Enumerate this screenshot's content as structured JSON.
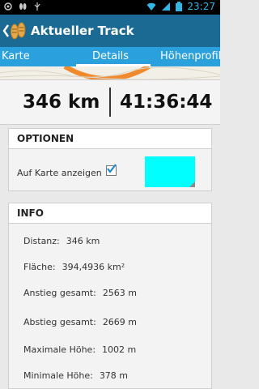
{
  "status_bar": {
    "time": "23:27",
    "icons": [
      "location-icon",
      "footprints-icon",
      "usb-icon",
      "wifi-icon",
      "signal-icon",
      "battery-icon"
    ]
  },
  "action_bar": {
    "title": "Aktueller Track",
    "icons": [
      "back-chevron-icon",
      "footprints-logo-icon"
    ]
  },
  "tabs": {
    "left": "Karte",
    "center": "Details",
    "right": "Höhenprofil"
  },
  "stats": {
    "distance": "346 km",
    "duration": "41:36:44"
  },
  "options": {
    "title": "OPTIONEN",
    "show_on_map_label": "Auf Karte anzeigen",
    "show_on_map_checked": true,
    "track_color": "#00ffff"
  },
  "info": {
    "title": "INFO",
    "rows": [
      {
        "label": "Distanz:",
        "value": "346 km"
      },
      {
        "label": "Fläche:",
        "value": "394,4936 km²"
      },
      {
        "label": "Anstieg gesamt:",
        "value": "2563 m"
      },
      {
        "label": "Abstieg gesamt:",
        "value": "2669 m"
      },
      {
        "label": "Maximale Höhe:",
        "value": "1002 m"
      },
      {
        "label": "Minimale Höhe:",
        "value": "378 m"
      }
    ]
  },
  "colors": {
    "action_bar": "#1b6a93",
    "tab_bar": "#2aa0dc",
    "status_accent": "#33b5e5",
    "checkbox_accent": "#1e88c8"
  }
}
